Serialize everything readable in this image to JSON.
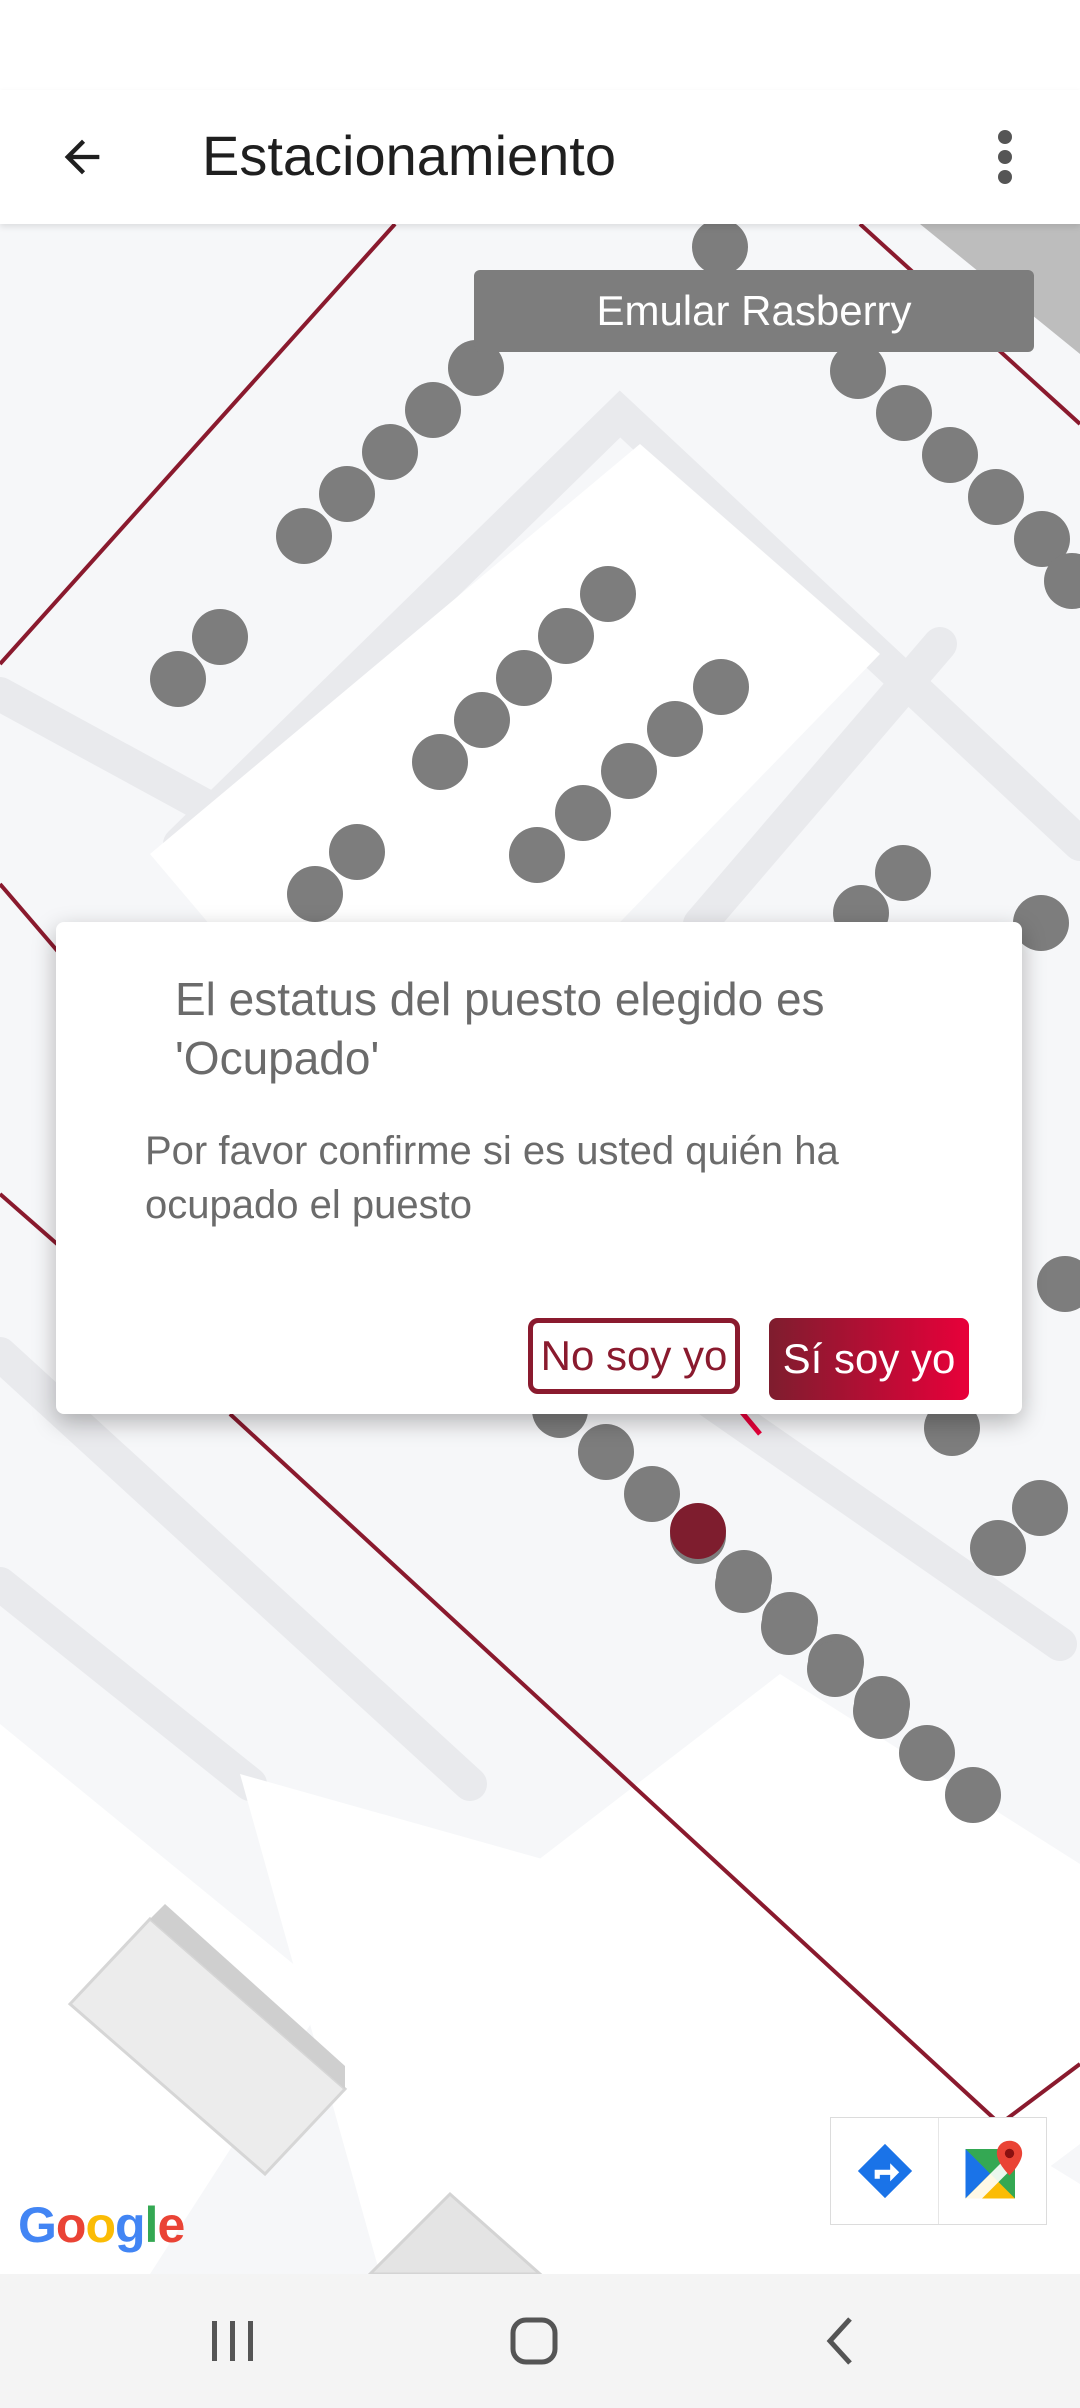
{
  "app_bar": {
    "title": "Estacionamiento",
    "back_icon": "arrow-left-icon",
    "menu_icon": "more-vert-icon"
  },
  "map": {
    "emular_label": "Emular Rasberry",
    "logo_text": "Google",
    "directions_icon": "directions-icon",
    "maps_icon": "google-maps-icon",
    "colors": {
      "spot_free": "#7d7d7d",
      "spot_selected": "#7e1d2e",
      "boundary": "#8a1a2e"
    }
  },
  "dialog": {
    "title": "El estatus del puesto elegido es 'Ocupado'",
    "message": "Por favor confirme si es usted quién ha ocupado el puesto",
    "no_label": "No soy yo",
    "yes_label": "Sí soy yo",
    "accent": "#8a1a2e"
  },
  "nav_bar": {
    "recents_icon": "recents-icon",
    "home_icon": "home-icon",
    "back_icon": "nav-back-icon"
  }
}
